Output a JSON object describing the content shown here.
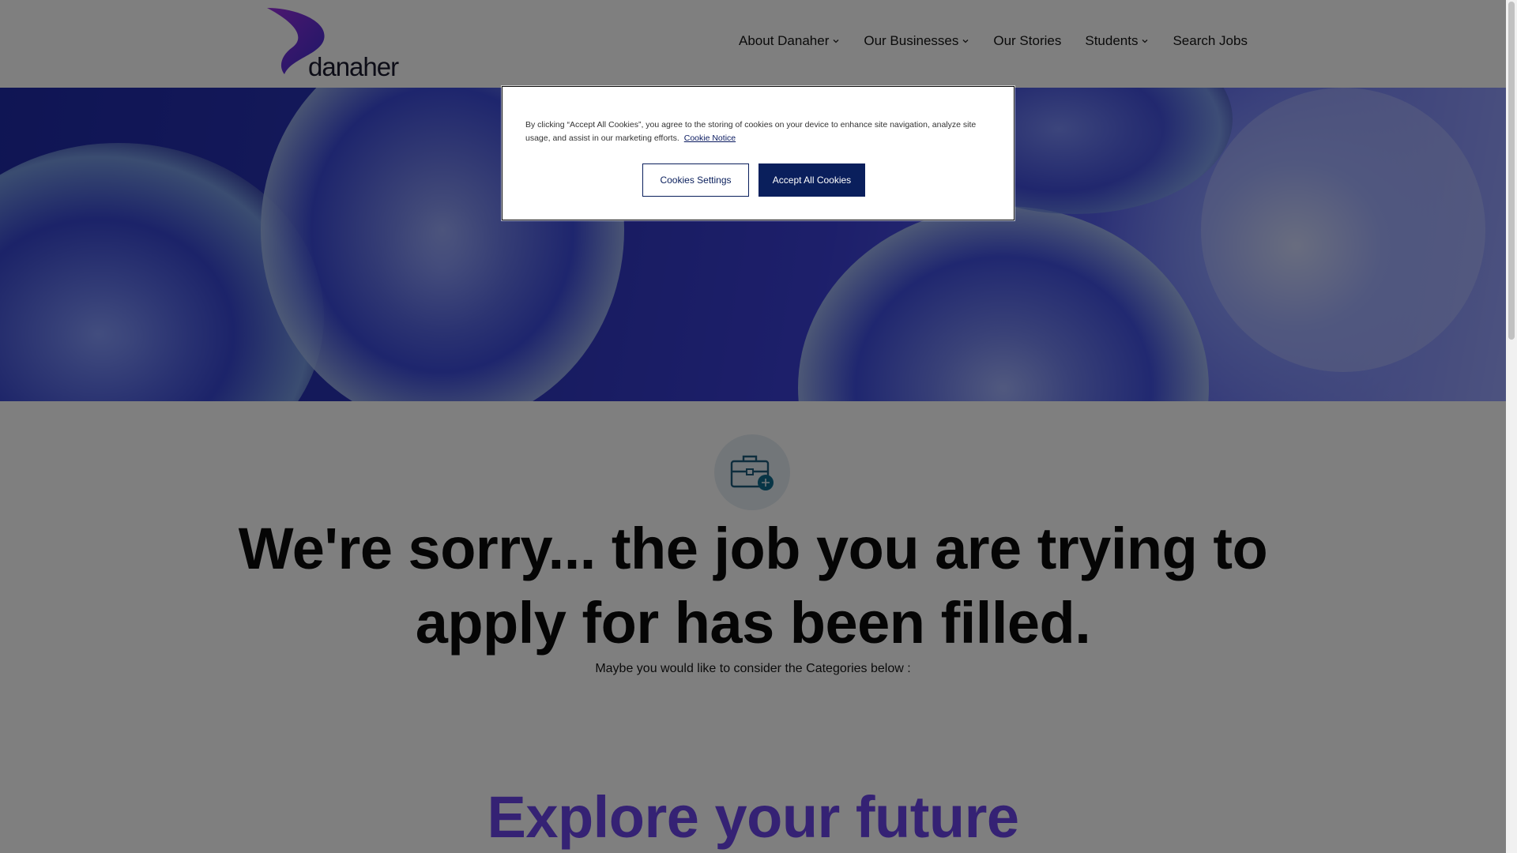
{
  "brand": {
    "name": "danaher",
    "logo_colors": [
      "#7b2ff7",
      "#3a2fd0"
    ]
  },
  "nav": {
    "items": [
      {
        "label": "About Danaher",
        "has_dropdown": true
      },
      {
        "label": "Our Businesses",
        "has_dropdown": true
      },
      {
        "label": "Our Stories",
        "has_dropdown": false
      },
      {
        "label": "Students",
        "has_dropdown": true
      },
      {
        "label": "Search Jobs",
        "has_dropdown": false
      }
    ]
  },
  "hero": {
    "image": "blue-cell-spheres"
  },
  "main": {
    "icon": "briefcase-plus-icon",
    "headline": "We're sorry... the job you are trying to apply for has been filled.",
    "subtext": "Maybe you would like to consider the Categories below :",
    "explore_heading": "Explore your future"
  },
  "cookie_banner": {
    "text": "By clicking “Accept All Cookies”, you agree to the storing of cookies on your device to enhance site navigation, analyze site usage, and assist in our marketing efforts.",
    "link_label": "Cookie Notice",
    "settings_label": "Cookies Settings",
    "accept_label": "Accept All Cookies"
  },
  "colors": {
    "accent_purple": "#6b45e8",
    "button_navy": "#0a1f5c",
    "overlay": "rgba(0,0,0,0.5)"
  }
}
